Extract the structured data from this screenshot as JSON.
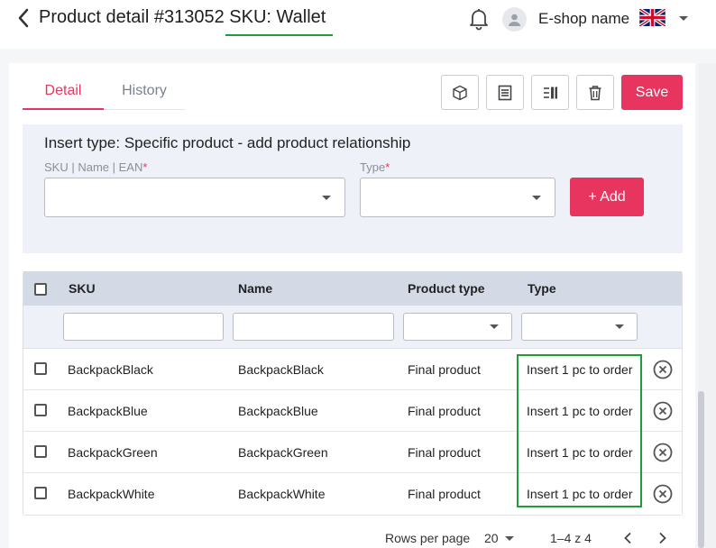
{
  "header": {
    "title_prefix": "Product detail #313052",
    "title_sku": "SKU: Wallet",
    "shop_name": "E-shop name",
    "icons": [
      "chevron-left-icon",
      "bell-icon",
      "user-icon",
      "uk-flag-icon",
      "chevron-down-icon"
    ]
  },
  "tabs": [
    {
      "label": "Detail",
      "active": true
    },
    {
      "label": "History",
      "active": false
    }
  ],
  "toolbar": {
    "icons": [
      "box-icon",
      "list-icon",
      "columns-icon",
      "trash-icon"
    ],
    "save_label": "Save"
  },
  "insert_panel": {
    "title": "Insert type: Specific product - add product relationship",
    "sku_label": "SKU | Name | EAN",
    "type_label": "Type",
    "required_mark": "*",
    "sku_value": "",
    "type_value": "",
    "add_label": "+ Add"
  },
  "table": {
    "columns": [
      "SKU",
      "Name",
      "Product type",
      "Type"
    ],
    "rows": [
      {
        "sku": "BackpackBlack",
        "name": "BackpackBlack",
        "product_type": "Final product",
        "type": "Insert 1 pc to order"
      },
      {
        "sku": "BackpackBlue",
        "name": "BackpackBlue",
        "product_type": "Final product",
        "type": "Insert 1 pc to order"
      },
      {
        "sku": "BackpackGreen",
        "name": "BackpackGreen",
        "product_type": "Final product",
        "type": "Insert 1 pc to order"
      },
      {
        "sku": "BackpackWhite",
        "name": "BackpackWhite",
        "product_type": "Final product",
        "type": "Insert 1 pc to order"
      }
    ]
  },
  "footer": {
    "rows_per_page_label": "Rows per page",
    "rows_per_page": "20",
    "range": "1–4 z 4"
  },
  "colors": {
    "accent": "#e8355f",
    "highlight": "#1f9d3a",
    "panel_bg": "#eef1f8",
    "header_row_bg": "#d4d9e6"
  }
}
